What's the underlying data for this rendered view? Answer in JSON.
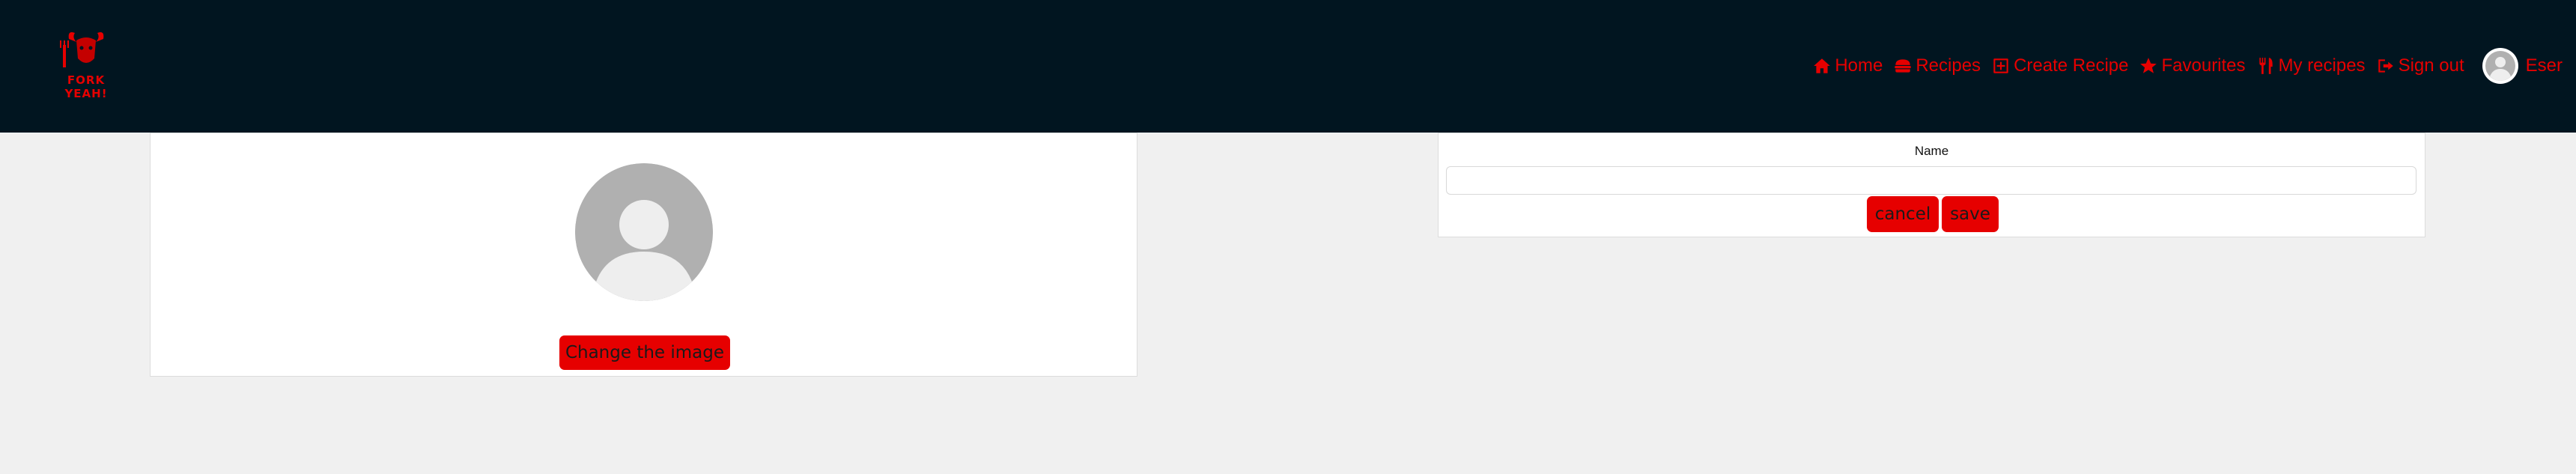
{
  "header": {
    "logo_text": "FORK YEAH!",
    "nav": [
      {
        "label": "Home",
        "icon": "home-icon"
      },
      {
        "label": "Recipes",
        "icon": "burger-icon"
      },
      {
        "label": "Create Recipe",
        "icon": "plus-square-icon"
      },
      {
        "label": "Favourites",
        "icon": "star-icon"
      },
      {
        "label": "My recipes",
        "icon": "utensils-icon"
      },
      {
        "label": "Sign out",
        "icon": "sign-out-icon"
      }
    ],
    "user_name": "Eser"
  },
  "profile": {
    "change_image_label": "Change the image"
  },
  "edit_form": {
    "name_label": "Name",
    "name_value": "",
    "cancel_label": "cancel",
    "save_label": "save"
  },
  "colors": {
    "accent": "#e60000",
    "header_bg": "#011520",
    "page_bg": "#f0f0f0"
  }
}
